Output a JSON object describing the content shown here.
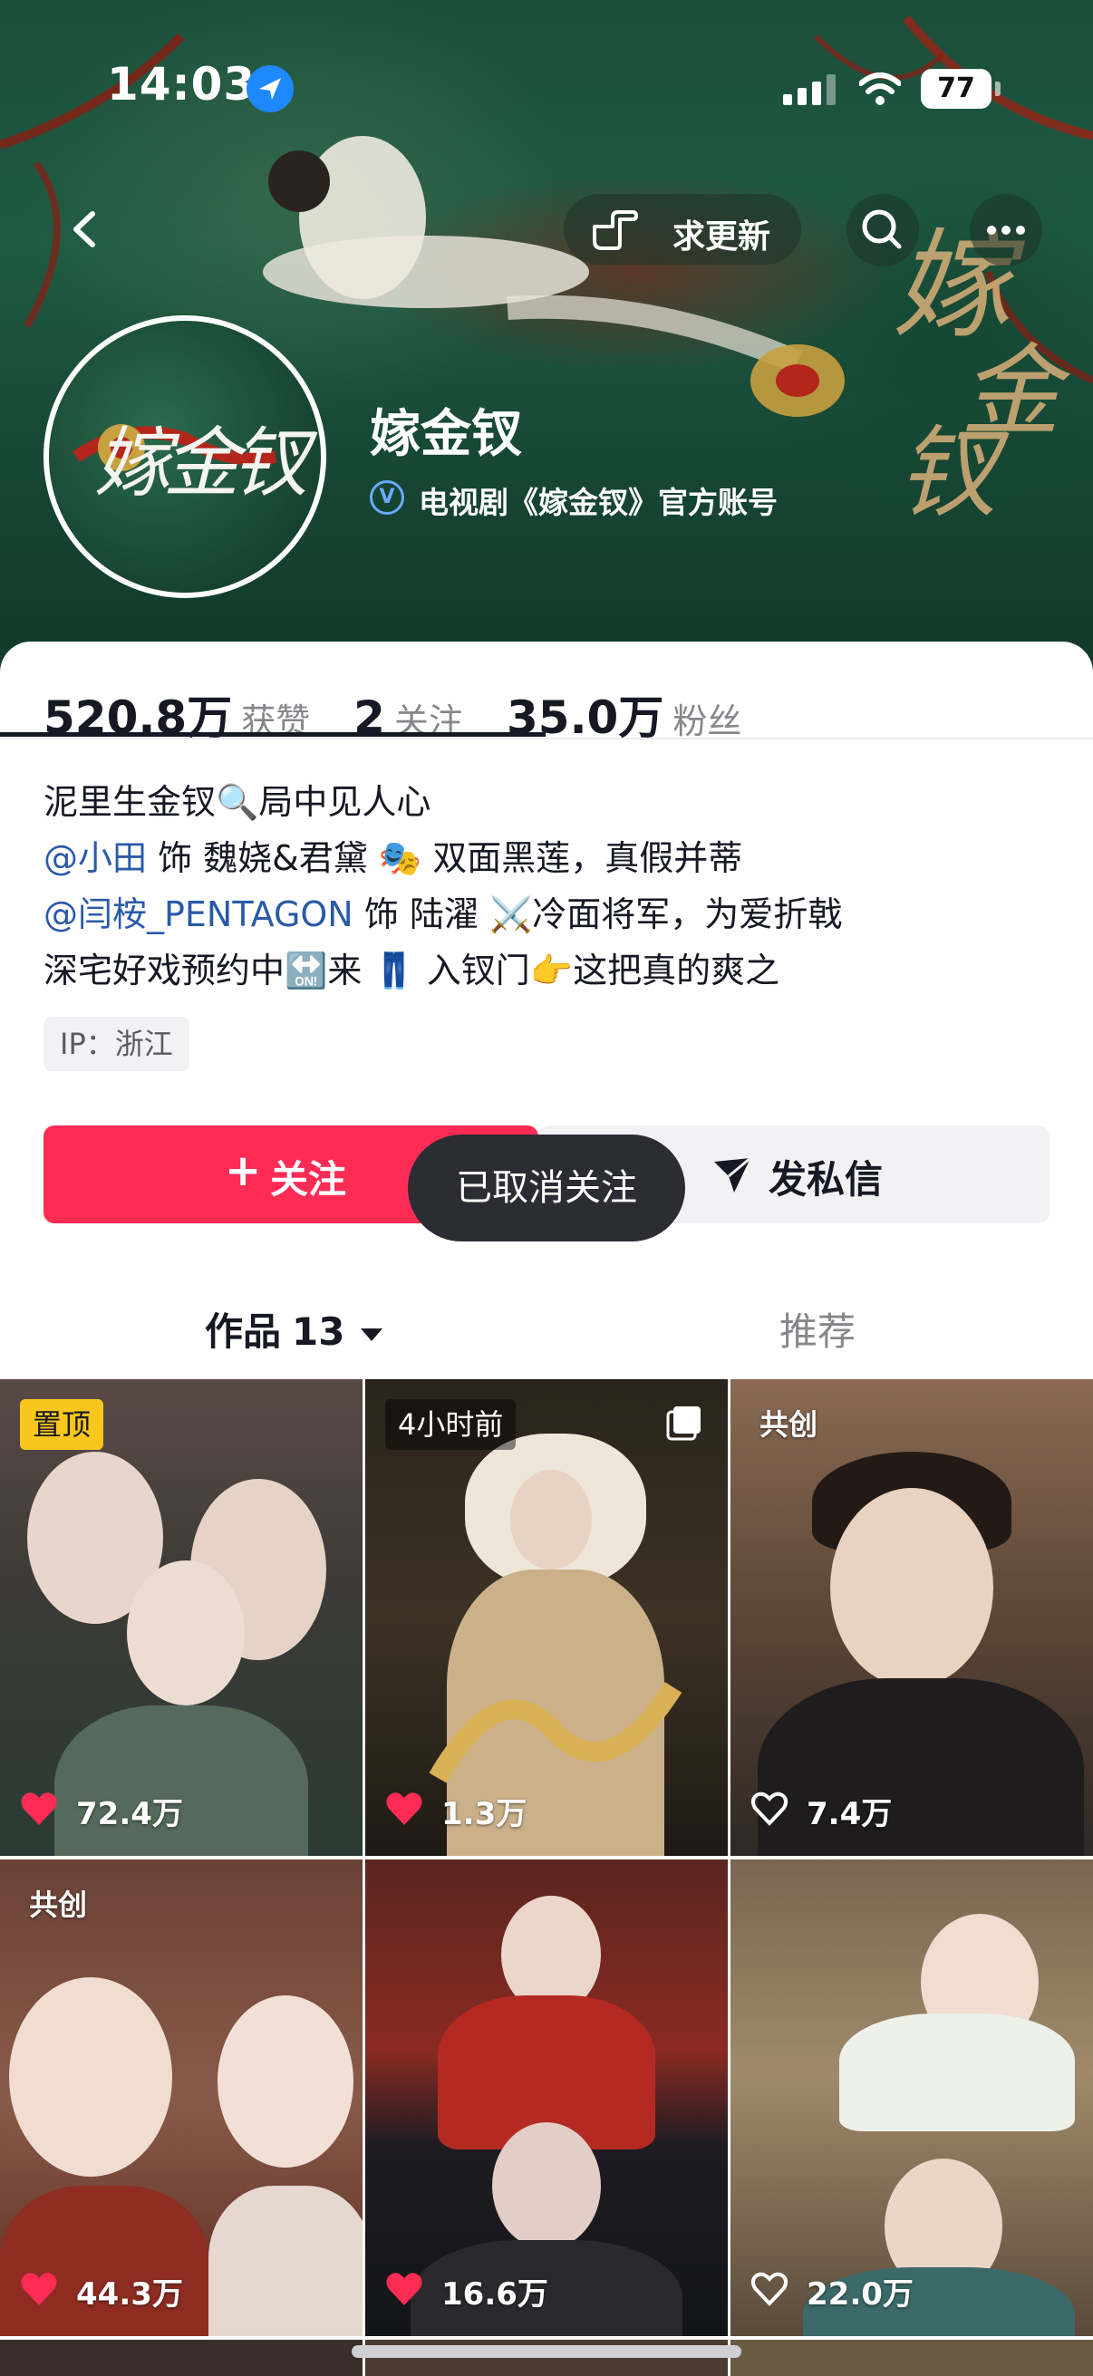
{
  "status_bar": {
    "time": "14:03",
    "battery": "77"
  },
  "nav": {
    "update_label": "求更新"
  },
  "profile": {
    "name": "嫁金钗",
    "avatar_text": "嫁金钗",
    "verify_text": "电视剧《嫁金钗》官方账号",
    "stats": [
      {
        "value": "520.8万",
        "label": "获赞"
      },
      {
        "value": "2",
        "label": "关注"
      },
      {
        "value": "35.0万",
        "label": "粉丝"
      }
    ],
    "bio": {
      "line1": "泥里生金钗🔍局中见人心",
      "line2_mention": "@小田",
      "line2_rest": " 饰 魏娆&君黛 🎭 双面黑莲，真假并蒂",
      "line3_mention": "@闫桉_PENTAGON",
      "line3_rest": " 饰 陆濯 ⚔️冷面将军，为爱折戟",
      "line4": "深宅好戏预约中🔛来 👖 入钗门👉这把真的爽之"
    },
    "ip": "IP：浙江"
  },
  "actions": {
    "follow_label": "关注",
    "follow_plus": "+",
    "message_label": "发私信"
  },
  "toast": "已取消关注",
  "tabs": {
    "works_label": "作品",
    "works_count": "13",
    "recommend_label": "推荐"
  },
  "videos": [
    {
      "badge": "置顶",
      "likes": "72.4万",
      "liked": true
    },
    {
      "badge": "4小时前",
      "likes": "1.3万",
      "liked": true
    },
    {
      "badge": "共创",
      "likes": "7.4万",
      "liked": false
    },
    {
      "badge": "共创",
      "likes": "44.3万",
      "liked": true
    },
    {
      "badge": "",
      "likes": "16.6万",
      "liked": true
    },
    {
      "badge": "",
      "likes": "22.0万",
      "liked": false
    }
  ],
  "colors": {
    "accent": "#fe2c55",
    "pin_badge": "#f8c61d",
    "mention": "#2a5aa8",
    "banner": "#1b4e3a"
  }
}
